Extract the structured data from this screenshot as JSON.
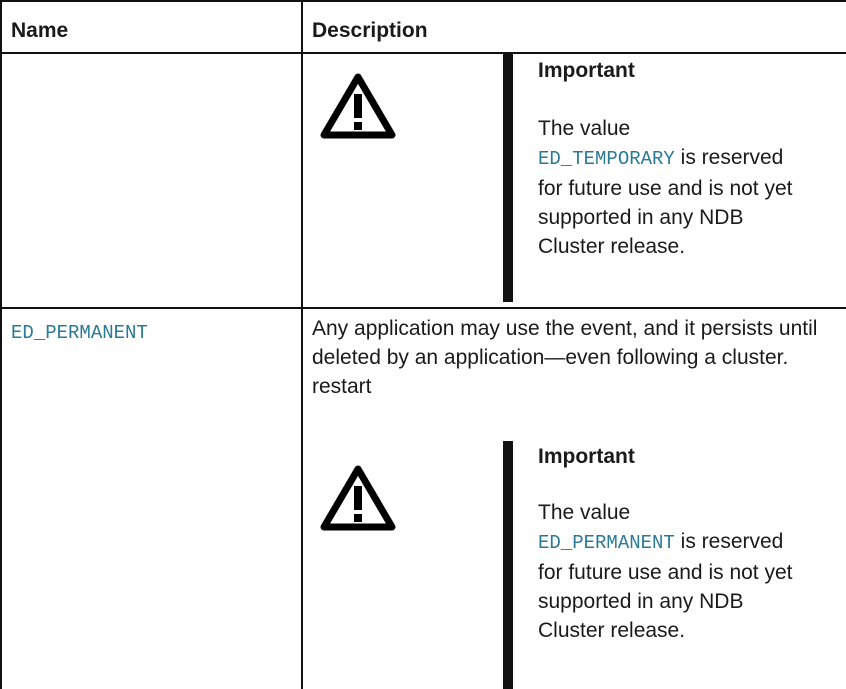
{
  "table": {
    "headers": {
      "name": "Name",
      "description": "Description"
    },
    "rows": [
      {
        "name": "",
        "description": "",
        "admonition": {
          "icon": "warning-icon",
          "title": "Important",
          "text_before": "The value",
          "code": "ED_TEMPORARY",
          "text_after": " is reserved for future use and is not yet supported in any NDB Cluster release."
        }
      },
      {
        "name": "ED_PERMANENT",
        "description": "Any application may use the event, and it persists until deleted by an application—even following a cluster. restart",
        "admonition": {
          "icon": "warning-icon",
          "title": "Important",
          "text_before": "The value",
          "code": "ED_PERMANENT",
          "text_after": " is reserved for future use and is not yet supported in any NDB Cluster release."
        }
      }
    ]
  },
  "colors": {
    "code": "#2a7a96",
    "border": "#111111",
    "text": "#1a1a1a"
  }
}
